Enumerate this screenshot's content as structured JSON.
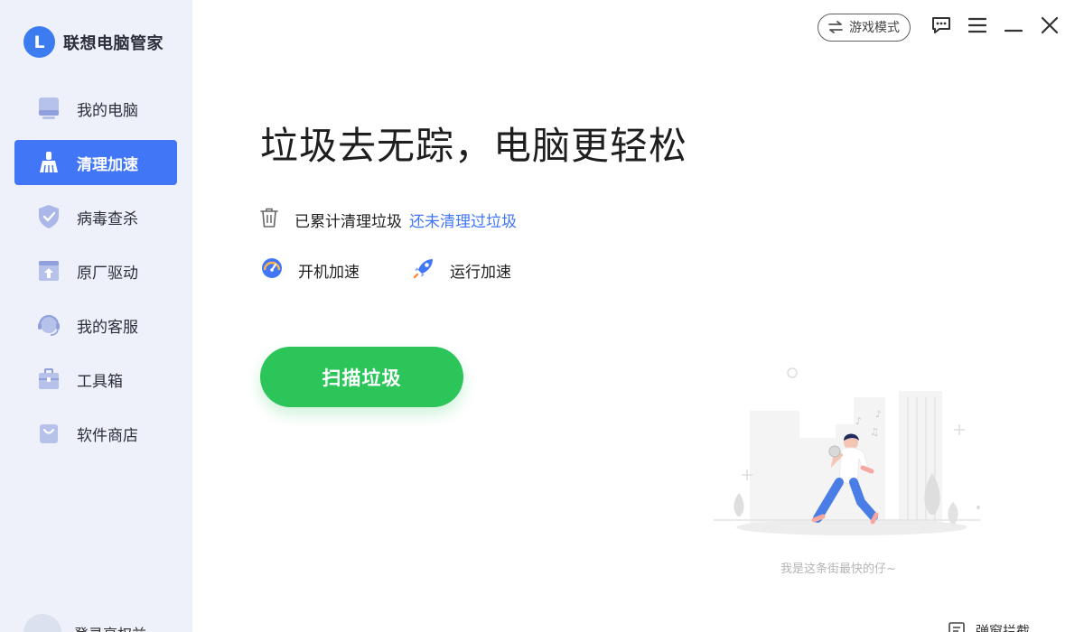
{
  "app": {
    "logo_letter": "L",
    "name": "联想电脑管家"
  },
  "sidebar": {
    "items": [
      {
        "label": "我的电脑",
        "icon": "computer-icon"
      },
      {
        "label": "清理加速",
        "icon": "broom-icon",
        "active": true
      },
      {
        "label": "病毒查杀",
        "icon": "shield-icon"
      },
      {
        "label": "原厂驱动",
        "icon": "driver-upload-icon"
      },
      {
        "label": "我的客服",
        "icon": "headset-icon"
      },
      {
        "label": "工具箱",
        "icon": "toolbox-icon"
      },
      {
        "label": "软件商店",
        "icon": "shopping-bag-icon"
      }
    ],
    "login_label": "登录享权益"
  },
  "topbar": {
    "game_mode_label": "游戏模式"
  },
  "main": {
    "headline": "垃圾去无踪，电脑更轻松",
    "stat_label": "已累计清理垃圾",
    "stat_link": "还未清理过垃圾",
    "boost_startup_label": "开机加速",
    "boost_runtime_label": "运行加速",
    "scan_button_label": "扫描垃圾",
    "illustration_caption": "我是这条街最快的仔~"
  },
  "bottom": {
    "popup_block_label": "弹窗拦截"
  },
  "colors": {
    "accent": "#4177f6",
    "scan_green": "#2bc55a",
    "sidebar_bg": "#eef1f9"
  }
}
